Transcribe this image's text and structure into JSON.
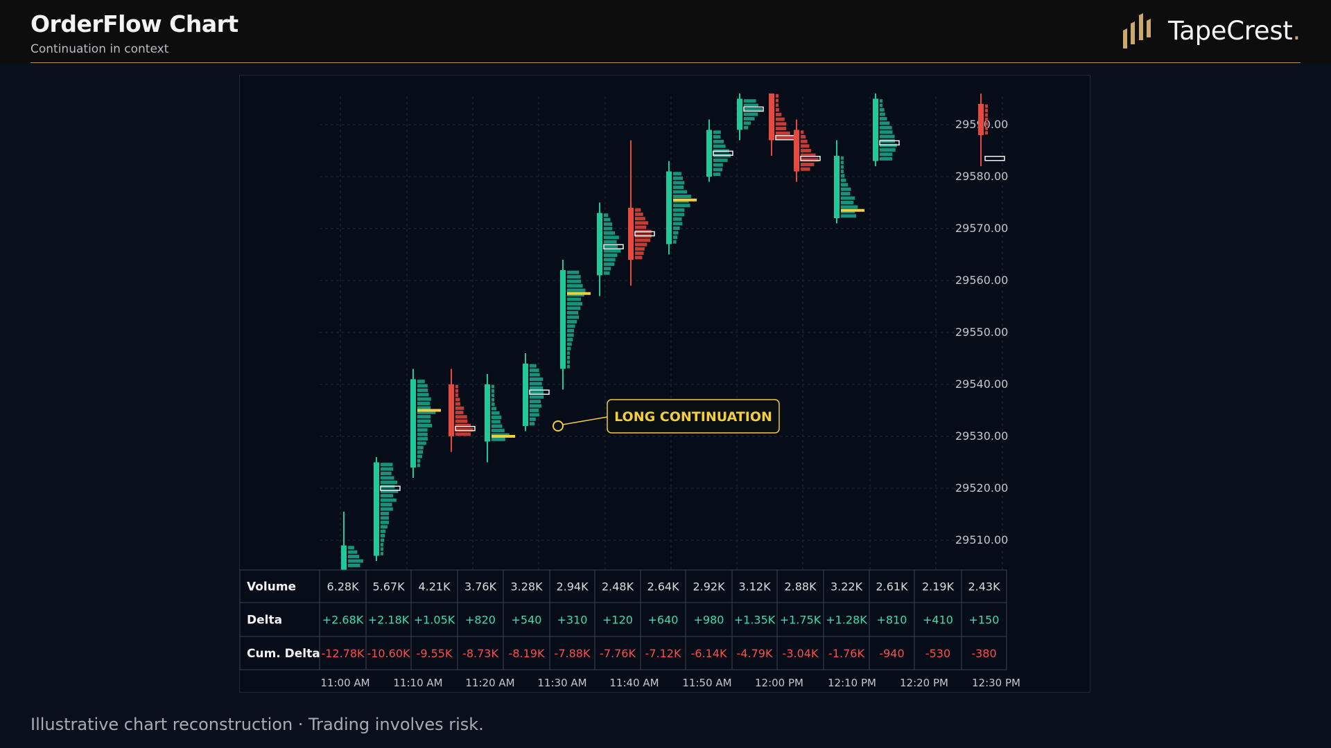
{
  "header": {
    "title": "OrderFlow Chart",
    "subtitle": "Continuation in context",
    "brand_name": "TapeCrest",
    "brand_dot": "."
  },
  "footer": {
    "disclaimer": "Illustrative chart reconstruction · Trading involves risk."
  },
  "colors": {
    "bull": "#1fc99a",
    "bull_profile": "#16937a",
    "bear": "#e8483d",
    "bear_profile": "#c43c35",
    "poc_yellow": "#f4cf3a",
    "accent_gold": "#c9a86a",
    "positive_text": "#34e0ad",
    "negative_text": "#ff4d4d"
  },
  "chart_data": {
    "type": "candlestick",
    "title": "",
    "xlabel": "",
    "ylabel": "",
    "ylim": [
      29503,
      29597
    ],
    "y_ticks": [
      "29510.00",
      "29520.00",
      "29530.00",
      "29540.00",
      "29550.00",
      "29560.00",
      "29570.00",
      "29580.00",
      "29590.00"
    ],
    "x_ticks": [
      "11:00 AM",
      "11:10 AM",
      "11:20 AM",
      "11:30 AM",
      "11:40 AM",
      "11:50 AM",
      "12:00 PM",
      "12:10 PM",
      "12:20 PM",
      "12:30 PM"
    ],
    "grid": true,
    "candles": [
      {
        "open": 29503,
        "high": 29515.5,
        "low": 29503,
        "close": 29509,
        "poc": null,
        "poc_color": null
      },
      {
        "open": 29507,
        "high": 29526,
        "low": 29506,
        "close": 29525,
        "poc": 29520,
        "poc_color": "white"
      },
      {
        "open": 29524,
        "high": 29543,
        "low": 29522,
        "close": 29541,
        "poc": 29535,
        "poc_color": "yellow"
      },
      {
        "open": 29540,
        "high": 29543,
        "low": 29527,
        "close": 29530,
        "poc": 29531.5,
        "poc_color": "white"
      },
      {
        "open": 29529,
        "high": 29542,
        "low": 29525,
        "close": 29540,
        "poc": 29530,
        "poc_color": "yellow"
      },
      {
        "open": 29532,
        "high": 29546,
        "low": 29531,
        "close": 29544,
        "poc": 29538.5,
        "poc_color": "white"
      },
      {
        "open": 29543,
        "high": 29564,
        "low": 29539,
        "close": 29562,
        "poc": 29557.5,
        "poc_color": "yellow"
      },
      {
        "open": 29561,
        "high": 29575,
        "low": 29557,
        "close": 29573,
        "poc": 29566.5,
        "poc_color": "white"
      },
      {
        "open": 29574,
        "high": 29587,
        "low": 29559,
        "close": 29564,
        "poc": 29569,
        "poc_color": "white"
      },
      {
        "open": 29567,
        "high": 29583,
        "low": 29565,
        "close": 29581,
        "poc": 29575.5,
        "poc_color": "yellow"
      },
      {
        "open": 29580,
        "high": 29591,
        "low": 29579,
        "close": 29589,
        "poc": 29584.5,
        "poc_color": "white"
      },
      {
        "open": 29589,
        "high": 29596,
        "low": 29587,
        "close": 29595,
        "poc": 29593,
        "poc_color": "white"
      },
      {
        "open": 29596,
        "high": 29596,
        "low": 29584,
        "close": 29587,
        "poc": 29587.5,
        "poc_color": "white"
      },
      {
        "open": 29589,
        "high": 29591,
        "low": 29579,
        "close": 29581,
        "poc": 29583.5,
        "poc_color": "white"
      },
      {
        "open": 29572,
        "high": 29587,
        "low": 29571,
        "close": 29584,
        "poc": 29573.5,
        "poc_color": "yellow"
      },
      {
        "open": 29583,
        "high": 29596,
        "low": 29582,
        "close": 29595,
        "poc": 29586.5,
        "poc_color": "white"
      },
      {
        "open": 29594,
        "high": 29596,
        "low": 29582,
        "close": 29588,
        "poc": 29583.5,
        "poc_color": "white"
      }
    ],
    "table": {
      "rows": [
        {
          "label": "Volume",
          "values": [
            "6.28K",
            "5.67K",
            "4.21K",
            "3.76K",
            "3.28K",
            "2.94K",
            "2.48K",
            "2.64K",
            "2.92K",
            "3.12K",
            "2.88K",
            "3.22K",
            "2.61K",
            "2.19K",
            "2.43K"
          ],
          "tone": "neutral"
        },
        {
          "label": "Delta",
          "values": [
            "+2.68K",
            "+2.18K",
            "+1.05K",
            "+820",
            "+540",
            "+310",
            "+120",
            "+640",
            "+980",
            "+1.35K",
            "+1.75K",
            "+1.28K",
            "+810",
            "+410",
            "+150"
          ],
          "tone": "positive"
        },
        {
          "label": "Cum. Delta",
          "values": [
            "-12.78K",
            "-10.60K",
            "-9.55K",
            "-8.73K",
            "-8.19K",
            "-7.88K",
            "-7.76K",
            "-7.12K",
            "-6.14K",
            "-4.79K",
            "-3.04K",
            "-1.76K",
            "-940",
            "-530",
            "-380"
          ],
          "tone": "negative"
        }
      ]
    },
    "annotation": {
      "label": "LONG CONTINUATION",
      "y": 29532
    }
  }
}
